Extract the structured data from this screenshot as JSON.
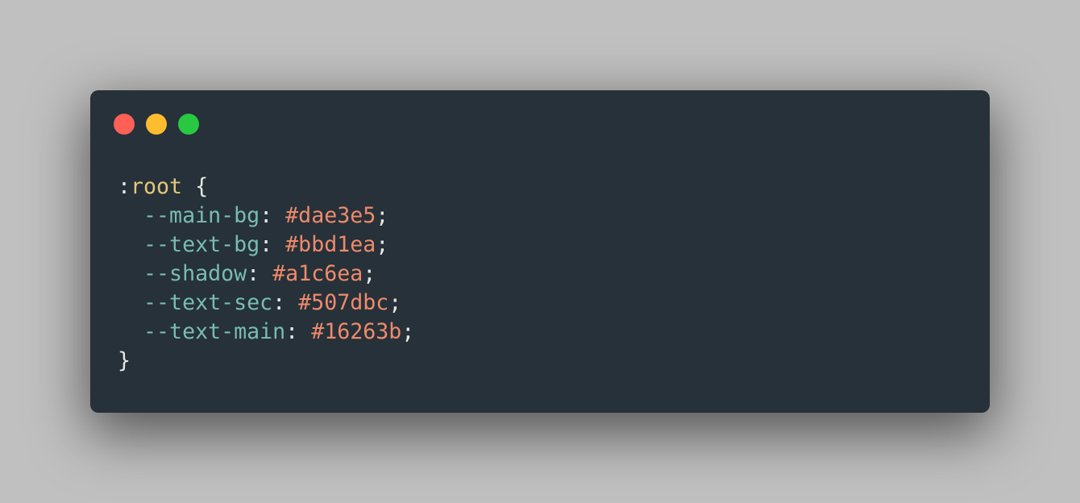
{
  "window": {
    "controls": [
      {
        "name": "close",
        "color": "#fe5f57"
      },
      {
        "name": "minimize",
        "color": "#febc2e"
      },
      {
        "name": "maximize",
        "color": "#28c840"
      }
    ]
  },
  "theme": {
    "background": "#263139",
    "punctuation": "#e6e6e6",
    "selector": "#e6c77a",
    "property": "#79bcb2",
    "value": "#ef8a6b"
  },
  "code": {
    "selector_prefix": ":",
    "selector": "root",
    "open_brace": " {",
    "close_brace": "}",
    "declarations": [
      {
        "property": "--main-bg",
        "value": "#dae3e5"
      },
      {
        "property": "--text-bg",
        "value": "#bbd1ea"
      },
      {
        "property": "--shadow",
        "value": "#a1c6ea"
      },
      {
        "property": "--text-sec",
        "value": "#507dbc"
      },
      {
        "property": "--text-main",
        "value": "#16263b"
      }
    ]
  }
}
